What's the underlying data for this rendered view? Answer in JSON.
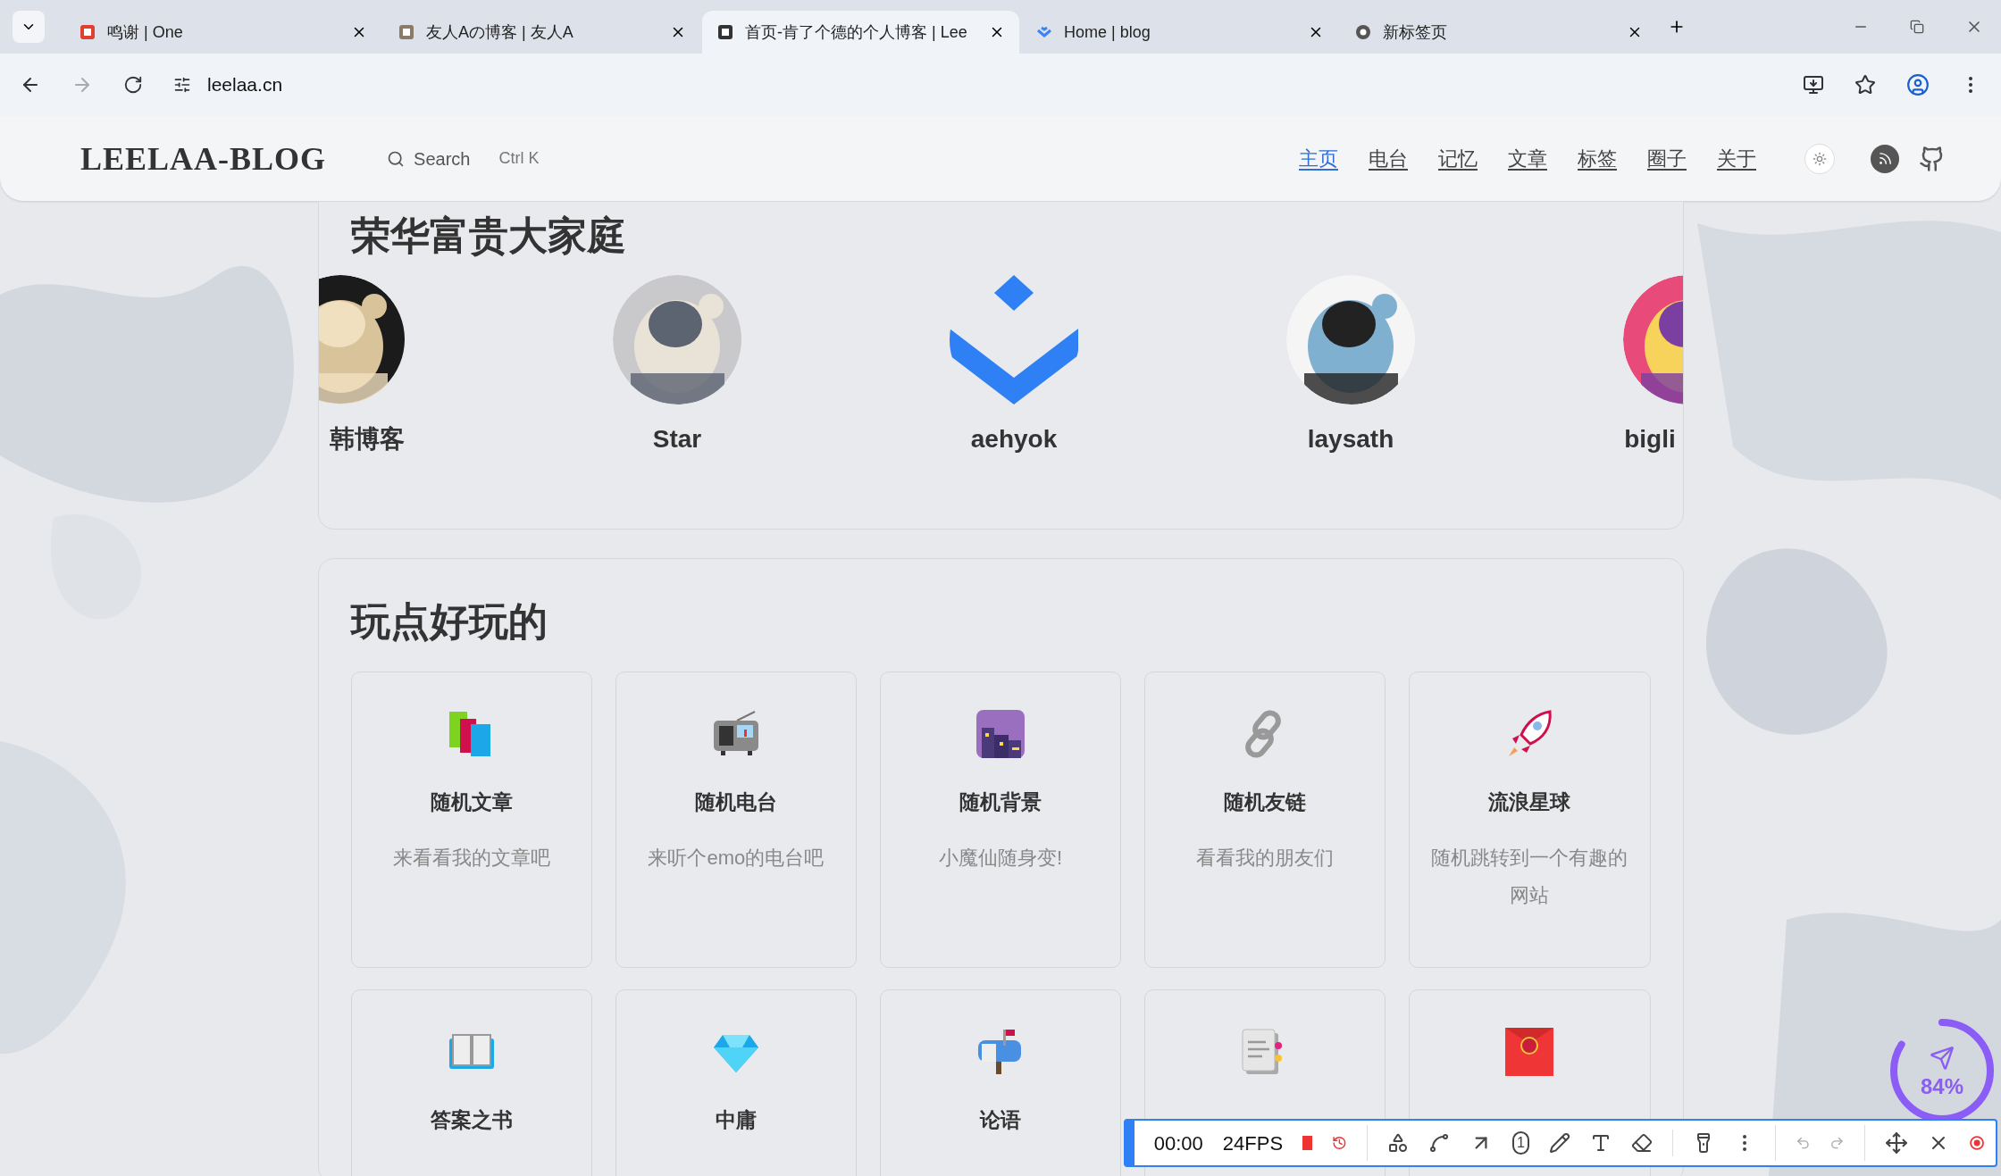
{
  "tabs": [
    {
      "title": "鸣谢 | One",
      "selected": false
    },
    {
      "title": "友人Aの博客 | 友人A",
      "selected": false
    },
    {
      "title": "首页-肯了个德的个人博客 | Lee",
      "selected": true
    },
    {
      "title": "Home | blog",
      "selected": false
    },
    {
      "title": "新标签页",
      "selected": false
    }
  ],
  "address": "leelaa.cn",
  "site": {
    "logo": "LEELAA-BLOG",
    "search": "Search",
    "shortcut": "Ctrl K",
    "nav": [
      {
        "label": "主页",
        "selected": true
      },
      {
        "label": "电台",
        "selected": false
      },
      {
        "label": "记忆",
        "selected": false
      },
      {
        "label": "文章",
        "selected": false
      },
      {
        "label": "标签",
        "selected": false
      },
      {
        "label": "圈子",
        "selected": false
      },
      {
        "label": "关于",
        "selected": false
      }
    ]
  },
  "friends": {
    "title": "荣华富贵大家庭",
    "items": [
      {
        "name": "韩博客",
        "kind": "picture"
      },
      {
        "name": "Star",
        "kind": "picture"
      },
      {
        "name": "aehyok",
        "kind": "logo"
      },
      {
        "name": "laysath",
        "kind": "picture"
      },
      {
        "name": "bigli",
        "kind": "picture"
      }
    ]
  },
  "fun": {
    "title": "玩点好玩的",
    "items": [
      {
        "kind": "tile",
        "title": "随机文章",
        "desc": "来看看我的文章吧"
      },
      {
        "kind": "tile",
        "title": "随机电台",
        "desc": "来听个emo的电台吧"
      },
      {
        "kind": "tile",
        "title": "随机背景",
        "desc": "小魔仙随身变!"
      },
      {
        "kind": "tile",
        "title": "随机友链",
        "desc": "看看我的朋友们"
      },
      {
        "kind": "tile",
        "title": "流浪星球",
        "desc": "随机跳转到一个有趣的网站"
      },
      {
        "kind": "tile",
        "title": "答案之书"
      },
      {
        "kind": "tile",
        "title": "中庸"
      },
      {
        "kind": "tile",
        "title": "论语"
      },
      {
        "kind": "tile"
      },
      {
        "kind": "tile"
      }
    ]
  },
  "recorder": {
    "time": "00:00",
    "fps": "24FPS",
    "step": "1"
  },
  "progress": {
    "label": "84%",
    "level": 0.84
  }
}
